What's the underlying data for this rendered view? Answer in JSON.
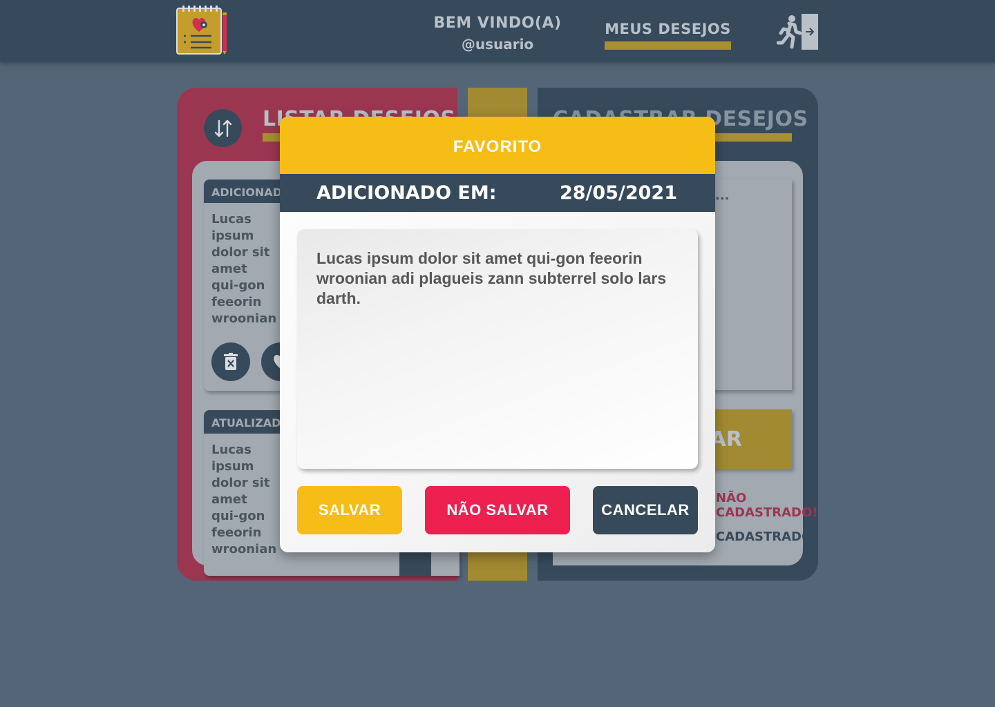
{
  "header": {
    "welcome_line1": "BEM VINDO(A)",
    "welcome_line2": "@usuario",
    "nav_wishes": "MEUS DESEJOS",
    "logo_icon": "wishlist-notepad-icon",
    "exit_icon": "exit-door-icon"
  },
  "list_panel": {
    "title": "LISTAR DESEJOS",
    "sort_icon": "sort-arrows-icon",
    "items": [
      {
        "head": "ADICIONADO",
        "text": "Lucas ipsum dolor sit amet qui-gon feeorin wroonian adi plagueis zann subterrel solo lars darth..."
      },
      {
        "head": "ATUALIZADO",
        "text": "Lucas ipsum dolor sit amet qui-gon feeorin wroonian adi plagueis zann subterrel solo lars darth..."
      }
    ]
  },
  "register_panel": {
    "title": "CADASTRAR DESEJOS",
    "placeholder_dots": "...",
    "save_label": "SALVAR",
    "msg_error": "NÃO CADASTRADO!",
    "msg_success": "CADASTRADO!"
  },
  "modal": {
    "title": "FAVORITO",
    "date_label": "ADICIONADO EM:",
    "date_value": "28/05/2021",
    "text": "Lucas ipsum dolor sit amet qui-gon feeorin wroonian adi plagueis zann subterrel solo lars darth.",
    "save_button": "SALVAR",
    "nosave_button": "NÃO SALVAR",
    "cancel_button": "CANCELAR"
  },
  "colors": {
    "background": "#546577",
    "navy": "#374a5b",
    "yellow": "#f6bd16",
    "red": "#ed2050",
    "crimson": "#9b3651",
    "gold": "#a88f31"
  }
}
